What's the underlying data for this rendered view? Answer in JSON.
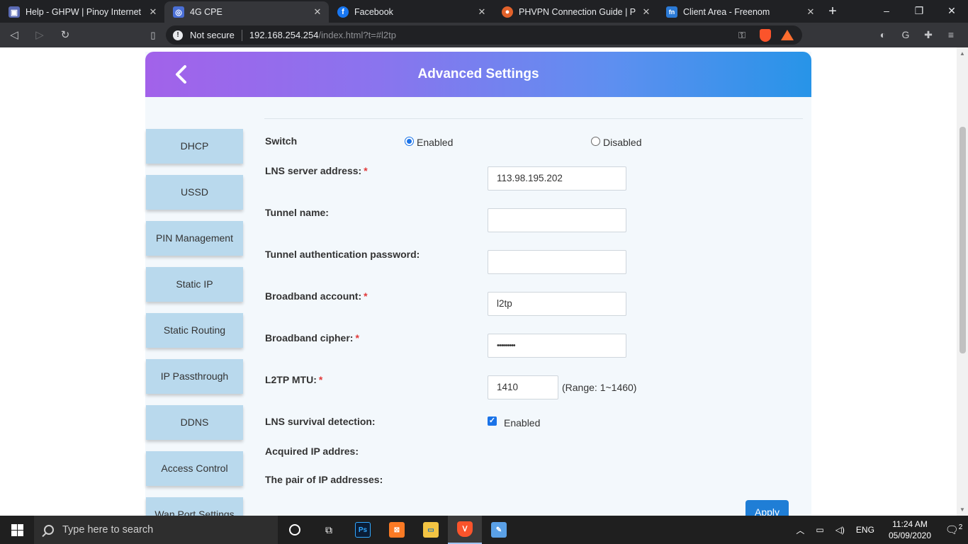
{
  "browser": {
    "tabs": [
      {
        "title": "Help - GHPW | Pinoy Internet and",
        "favicon_color": "#5b6bb5",
        "favicon_glyph": "box-icon",
        "active": false
      },
      {
        "title": "4G CPE",
        "favicon_color": "#4a6fd6",
        "favicon_glyph": "globe-icon",
        "active": true
      },
      {
        "title": "Facebook",
        "favicon_color": "#1877f2",
        "favicon_glyph": "f",
        "active": false
      },
      {
        "title": "PHVPN Connection Guide | Philip",
        "favicon_color": "#e2622b",
        "favicon_glyph": "o",
        "active": false
      },
      {
        "title": "Client Area - Freenom",
        "favicon_color": "#2b7ad6",
        "favicon_glyph": "fn",
        "active": false
      }
    ],
    "new_tab": "+",
    "window_controls": {
      "minimize": "–",
      "restore": "❐",
      "close": "✕"
    },
    "nav": {
      "back": "◁",
      "forward": "▷",
      "reload": "↻",
      "bookmark": "🔖"
    },
    "address": {
      "security_label": "Not secure",
      "host": "192.168.254.254",
      "path": "/index.html?t=#l2tp"
    }
  },
  "app": {
    "title": "Advanced Settings",
    "sidebar": [
      {
        "label": "DHCP"
      },
      {
        "label": "USSD"
      },
      {
        "label": "PIN Management"
      },
      {
        "label": "Static IP"
      },
      {
        "label": "Static Routing"
      },
      {
        "label": "IP Passthrough"
      },
      {
        "label": "DDNS"
      },
      {
        "label": "Access Control"
      },
      {
        "label": "Wan Port Settings"
      }
    ],
    "form": {
      "switch_label": "Switch",
      "switch_enabled": "Enabled",
      "switch_disabled": "Disabled",
      "switch_value": "Enabled",
      "lns_label": "LNS server address:",
      "lns_value": "113.98.195.202",
      "tunnel_name_label": "Tunnel name:",
      "tunnel_name_value": "",
      "tunnel_pw_label": "Tunnel authentication password:",
      "tunnel_pw_value": "",
      "account_label": "Broadband account:",
      "account_value": "l2tp",
      "cipher_label": "Broadband cipher:",
      "cipher_value": "•••••••••",
      "mtu_label": "L2TP MTU:",
      "mtu_value": "1410",
      "mtu_hint": "(Range: 1~1460)",
      "survival_label": "LNS survival detection:",
      "survival_option": "Enabled",
      "acquired_label": "Acquired IP addres:",
      "pair_label": "The pair of IP addresses:",
      "required_mark": "*",
      "apply_label": "Apply"
    }
  },
  "taskbar": {
    "search_placeholder": "Type here to search",
    "tray": {
      "language": "ENG",
      "time": "11:24 AM",
      "date": "05/09/2020",
      "notifications": "2"
    }
  }
}
